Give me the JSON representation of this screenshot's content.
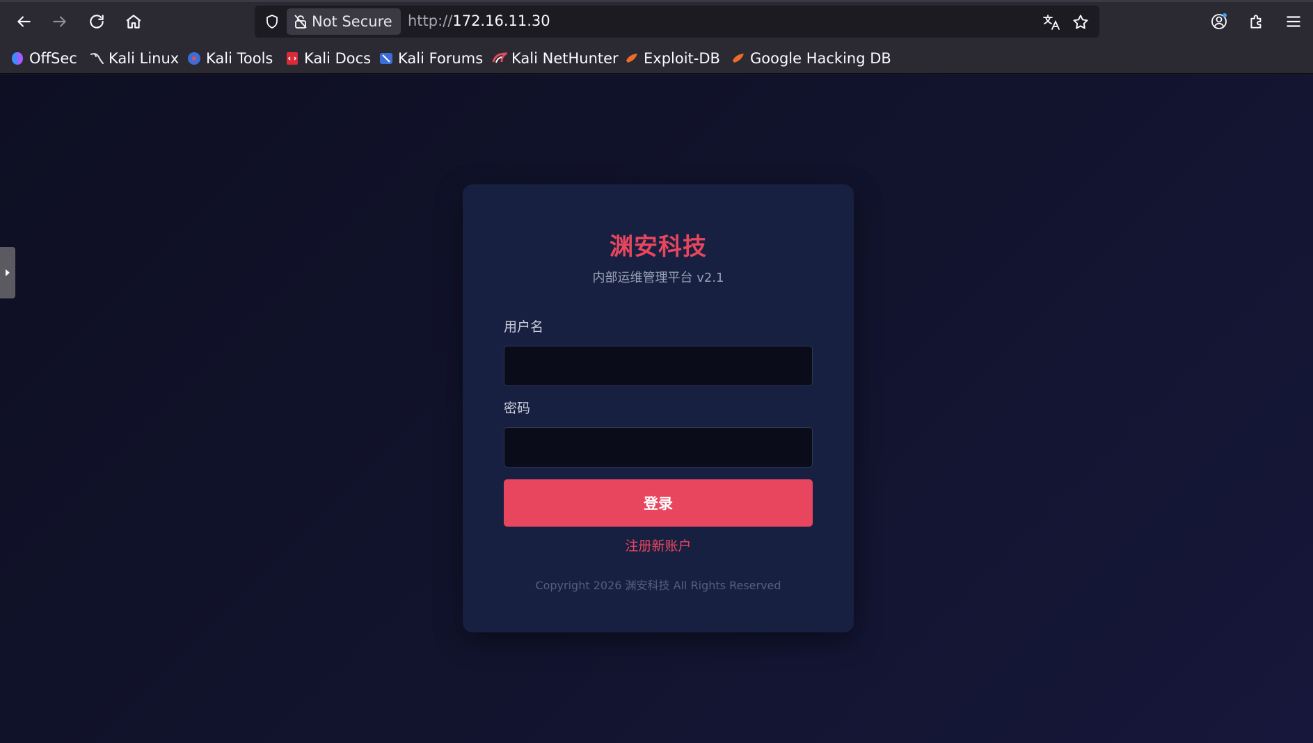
{
  "browser": {
    "security_label": "Not Secure",
    "url_scheme": "http://",
    "url_host": "172.16.11.30",
    "bookmarks": [
      {
        "label": "OffSec",
        "icon": "offsec-icon"
      },
      {
        "label": "Kali Linux",
        "icon": "kali-dragon-icon"
      },
      {
        "label": "Kali Tools",
        "icon": "kali-tools-icon"
      },
      {
        "label": "Kali Docs",
        "icon": "kali-docs-icon"
      },
      {
        "label": "Kali Forums",
        "icon": "kali-forums-icon"
      },
      {
        "label": "Kali NetHunter",
        "icon": "nethunter-icon"
      },
      {
        "label": "Exploit-DB",
        "icon": "exploit-db-icon"
      },
      {
        "label": "Google Hacking DB",
        "icon": "ghdb-icon"
      }
    ]
  },
  "login": {
    "brand": "渊安科技",
    "subtitle": "内部运维管理平台 v2.1",
    "username_label": "用户名",
    "username_value": "",
    "password_label": "密码",
    "password_value": "",
    "submit_label": "登录",
    "register_link": "注册新账户",
    "copyright": "Copyright 2026 渊安科技 All Rights Reserved"
  },
  "colors": {
    "accent": "#e8465f",
    "card_bg": "#172040",
    "page_bg": "#0e0f23"
  }
}
